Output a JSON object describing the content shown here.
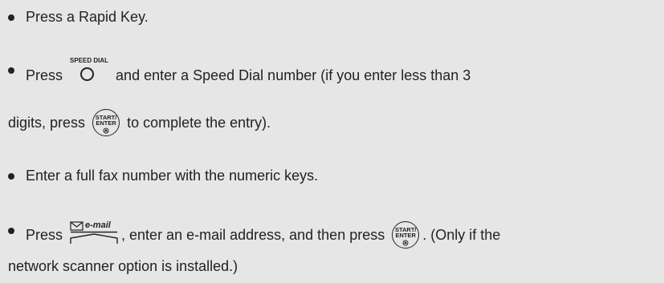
{
  "items": [
    {
      "lines": [
        "Press a Rapid Key."
      ]
    },
    {
      "line1_pre": "Press",
      "speed_dial_label": "SPEED DIAL",
      "line1_post": "and enter a Speed Dial number (if you enter less than 3",
      "line2_pre": "digits, press",
      "line2_post": "to complete the entry)."
    },
    {
      "lines": [
        "Enter a full fax number with the numeric keys."
      ]
    },
    {
      "line1_pre": "Press",
      "email_label": "e-mail",
      "line1_mid": ", enter an e-mail address, and then press",
      "line1_post": ". (Only if the",
      "line2": "network scanner option is installed.)"
    }
  ],
  "start_enter_key": {
    "top": "START/",
    "bottom": "ENTER"
  }
}
